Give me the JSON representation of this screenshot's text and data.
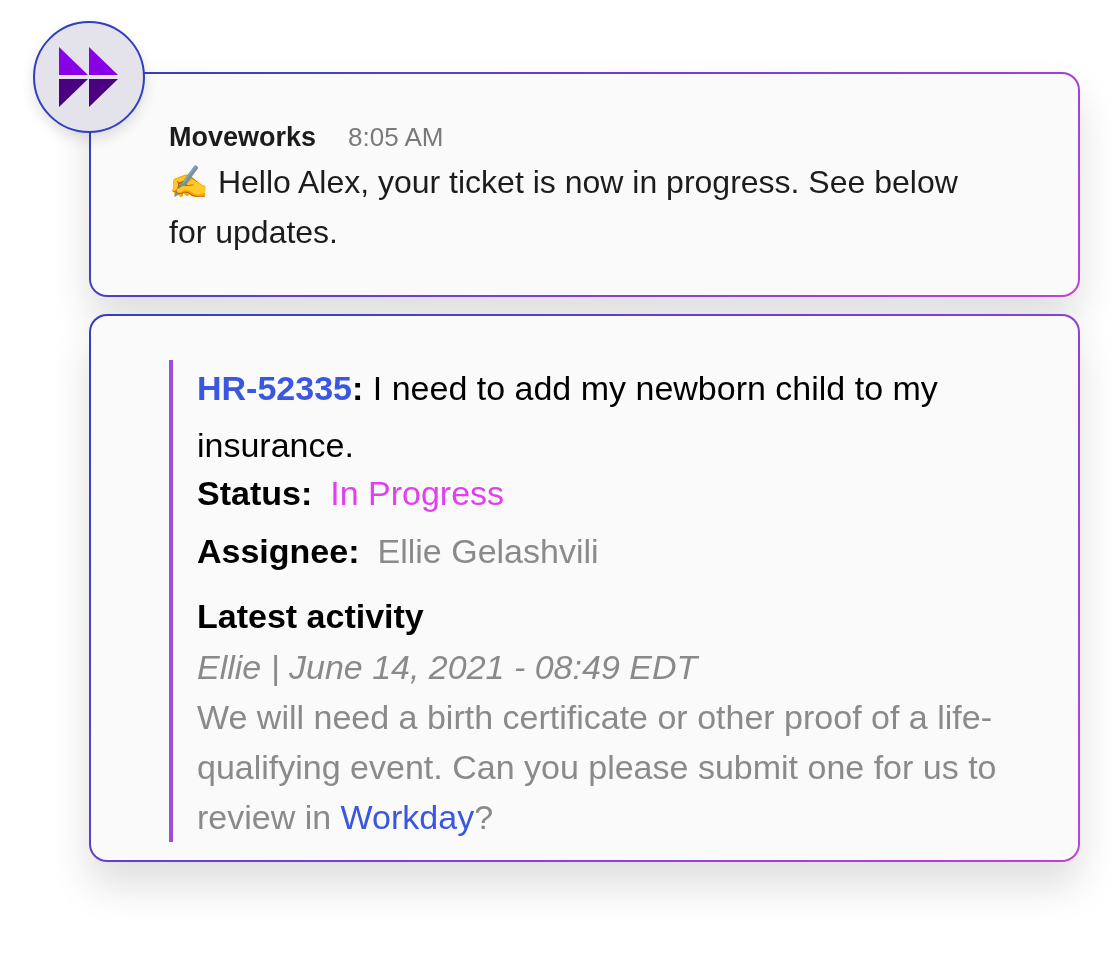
{
  "message": {
    "sender": "Moveworks",
    "time": "8:05 AM",
    "text": "✍ Hello Alex, your ticket is now in progress. See below for updates."
  },
  "ticket": {
    "id": "HR-52335",
    "summary": "**:** I need to add my newborn child to my insurance.",
    "fields": [
      {
        "label": "Status:",
        "value": "In Progress",
        "kind": "status"
      },
      {
        "label": "Assignee:",
        "value": "Ellie Gelashvili",
        "kind": "person"
      }
    ],
    "activity": {
      "heading": "Latest activity",
      "meta": "Ellie | June 14, 2021 - 08:49 EDT",
      "body_before": "We will need a birth certificate or other proof of a life-qualifying event. Can you please submit one for us to review in ",
      "link": "Workday",
      "body_after": "?"
    }
  }
}
